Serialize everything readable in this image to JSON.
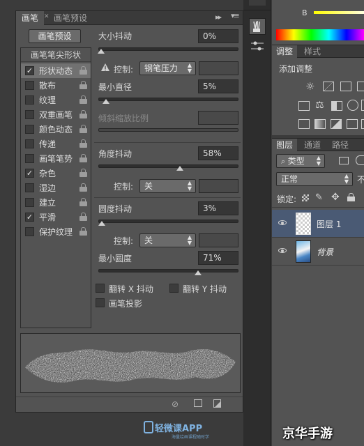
{
  "brush_panel": {
    "tabs": [
      "画笔",
      "画笔预设"
    ],
    "preset_button": "画笔预设",
    "tip_header": "画笔笔尖形状",
    "options": [
      {
        "label": "形状动态",
        "checked": true,
        "selected": true
      },
      {
        "label": "散布",
        "checked": false
      },
      {
        "label": "纹理",
        "checked": false
      },
      {
        "label": "双重画笔",
        "checked": false
      },
      {
        "label": "颜色动态",
        "checked": false
      },
      {
        "label": "传递",
        "checked": false
      },
      {
        "label": "画笔笔势",
        "checked": false
      },
      {
        "label": "杂色",
        "checked": true
      },
      {
        "label": "湿边",
        "checked": false
      },
      {
        "label": "建立",
        "checked": false
      },
      {
        "label": "平滑",
        "checked": true
      },
      {
        "label": "保护纹理",
        "checked": false
      }
    ],
    "size_jitter": {
      "label": "大小抖动",
      "value": "0%"
    },
    "control1": {
      "label": "控制:",
      "value": "钢笔压力"
    },
    "min_diameter": {
      "label": "最小直径",
      "value": "5%"
    },
    "tilt_scale": {
      "label": "倾斜缩放比例"
    },
    "angle_jitter": {
      "label": "角度抖动",
      "value": "58%"
    },
    "control2": {
      "label": "控制:",
      "value": "关"
    },
    "roundness_jitter": {
      "label": "圆度抖动",
      "value": "3%"
    },
    "control3": {
      "label": "控制:",
      "value": "关"
    },
    "min_roundness": {
      "label": "最小圆度",
      "value": "71%"
    },
    "flip_x": {
      "label": "翻转 X 抖动",
      "checked": false
    },
    "flip_y": {
      "label": "翻转 Y 抖动",
      "checked": false
    },
    "brush_projection": {
      "label": "画笔投影",
      "checked": false
    }
  },
  "right_panels": {
    "color": {
      "channel_label": "B"
    },
    "adjustments": {
      "tabs": [
        "调整",
        "样式"
      ],
      "title": "添加调整"
    },
    "layers": {
      "tabs": [
        "图层",
        "通道",
        "路径"
      ],
      "kind_filter": "类型",
      "blend_mode": "正常",
      "opacity_short": "不",
      "lock_label": "锁定:",
      "layers": [
        {
          "name": "图层 1",
          "selected": true
        },
        {
          "name": "背景",
          "selected": false
        }
      ]
    }
  },
  "watermarks": {
    "app_name": "轻微课APP",
    "app_sub": "海量绘画课程随时学",
    "site": "京华手游"
  },
  "colors": {
    "panel_bg": "#535353",
    "accent_blue": "#4a5a74",
    "selected_option": "#717171"
  }
}
